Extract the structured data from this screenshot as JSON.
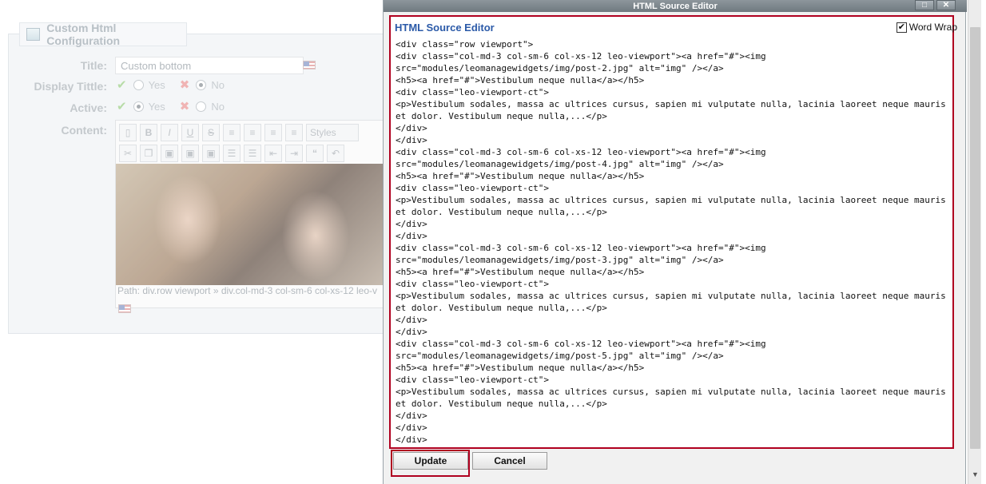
{
  "background": {
    "panel_title": "Custom Html Configuration",
    "title_label": "Title:",
    "title_value": "Custom bottom",
    "display_title_label": "Display Tittle:",
    "active_label": "Active:",
    "content_label": "Content:",
    "yes_label": "Yes",
    "no_label": "No",
    "styles_label": "Styles",
    "path_text": "Path: div.row viewport » div.col-md-3 col-sm-6 col-xs-12 leo-v"
  },
  "dialog": {
    "window_title": "HTML Source Editor",
    "heading": "HTML Source Editor",
    "word_wrap_label": "Word Wrap",
    "word_wrap_checked": true,
    "update_label": "Update",
    "cancel_label": "Cancel",
    "source_code": "<div class=\"row viewport\">\n<div class=\"col-md-3 col-sm-6 col-xs-12 leo-viewport\"><a href=\"#\"><img src=\"modules/leomanagewidgets/img/post-2.jpg\" alt=\"img\" /></a>\n<h5><a href=\"#\">Vestibulum neque nulla</a></h5>\n<div class=\"leo-viewport-ct\">\n<p>Vestibulum sodales, massa ac ultrices cursus, sapien mi vulputate nulla, lacinia laoreet neque mauris et dolor. Vestibulum neque nulla,...</p>\n</div>\n</div>\n<div class=\"col-md-3 col-sm-6 col-xs-12 leo-viewport\"><a href=\"#\"><img src=\"modules/leomanagewidgets/img/post-4.jpg\" alt=\"img\" /></a>\n<h5><a href=\"#\">Vestibulum neque nulla</a></h5>\n<div class=\"leo-viewport-ct\">\n<p>Vestibulum sodales, massa ac ultrices cursus, sapien mi vulputate nulla, lacinia laoreet neque mauris et dolor. Vestibulum neque nulla,...</p>\n</div>\n</div>\n<div class=\"col-md-3 col-sm-6 col-xs-12 leo-viewport\"><a href=\"#\"><img src=\"modules/leomanagewidgets/img/post-3.jpg\" alt=\"img\" /></a>\n<h5><a href=\"#\">Vestibulum neque nulla</a></h5>\n<div class=\"leo-viewport-ct\">\n<p>Vestibulum sodales, massa ac ultrices cursus, sapien mi vulputate nulla, lacinia laoreet neque mauris et dolor. Vestibulum neque nulla,...</p>\n</div>\n</div>\n<div class=\"col-md-3 col-sm-6 col-xs-12 leo-viewport\"><a href=\"#\"><img src=\"modules/leomanagewidgets/img/post-5.jpg\" alt=\"img\" /></a>\n<h5><a href=\"#\">Vestibulum neque nulla</a></h5>\n<div class=\"leo-viewport-ct\">\n<p>Vestibulum sodales, massa ac ultrices cursus, sapien mi vulputate nulla, lacinia laoreet neque mauris et dolor. Vestibulum neque nulla,...</p>\n</div>\n</div>\n</div>"
  },
  "colors": {
    "highlight_outline": "#b0001f",
    "heading_blue": "#2b5aa8"
  }
}
